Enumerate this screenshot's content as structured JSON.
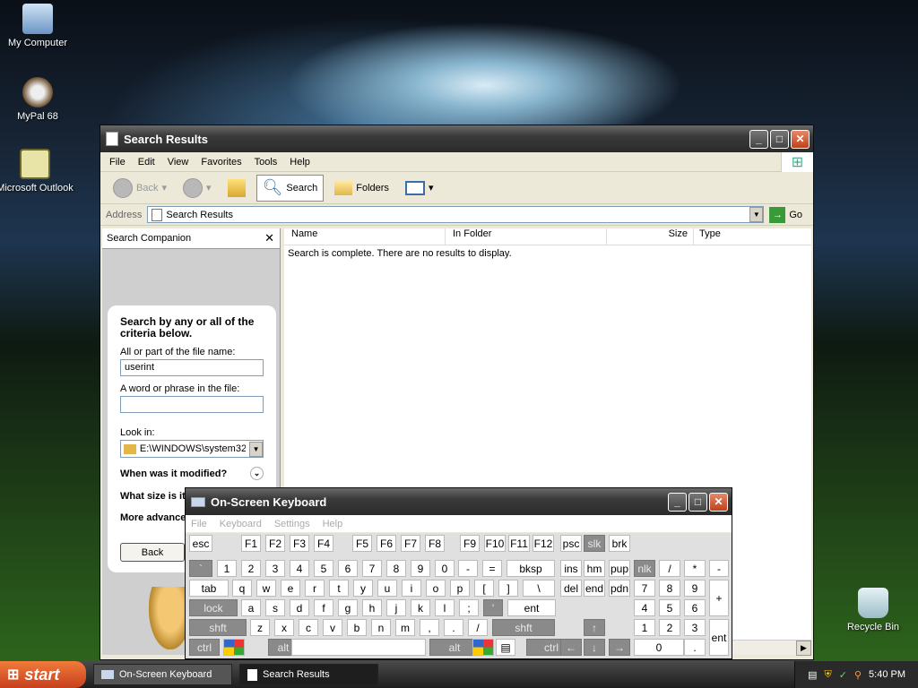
{
  "desktop": {
    "icons": [
      {
        "label": "My Computer"
      },
      {
        "label": "MyPal 68"
      },
      {
        "label": "Microsoft Outlook"
      },
      {
        "label": "Recycle Bin"
      }
    ]
  },
  "explorer": {
    "title": "Search Results",
    "menu": [
      "File",
      "Edit",
      "View",
      "Favorites",
      "Tools",
      "Help"
    ],
    "toolbar": {
      "back": "Back",
      "search": "Search",
      "folders": "Folders"
    },
    "address": {
      "label": "Address",
      "value": "Search Results",
      "go": "Go"
    },
    "companion": {
      "title": "Search Companion",
      "heading": "Search by any or all of the criteria below.",
      "file_label": "All or part of the file name:",
      "file_value": "userint",
      "word_label": "A word or phrase in the file:",
      "word_value": "",
      "look_label": "Look in:",
      "look_value": "E:\\WINDOWS\\system32",
      "modified": "When was it modified?",
      "size": "What size is it?",
      "advanced": "More advanced options",
      "back_btn": "Back"
    },
    "columns": [
      "Name",
      "In Folder",
      "Size",
      "Type"
    ],
    "message": "Search is complete. There are no results to display."
  },
  "osk": {
    "title": "On-Screen Keyboard",
    "menu": [
      "File",
      "Keyboard",
      "Settings",
      "Help"
    ],
    "rows": [
      [
        "esc",
        "F1",
        "F2",
        "F3",
        "F4",
        "F5",
        "F6",
        "F7",
        "F8",
        "F9",
        "F10",
        "F11",
        "F12",
        "psc",
        "slk",
        "brk"
      ],
      [
        "`",
        "1",
        "2",
        "3",
        "4",
        "5",
        "6",
        "7",
        "8",
        "9",
        "0",
        "-",
        "=",
        "bksp",
        "ins",
        "hm",
        "pup",
        "nlk",
        "/",
        "*",
        "-"
      ],
      [
        "tab",
        "q",
        "w",
        "e",
        "r",
        "t",
        "y",
        "u",
        "i",
        "o",
        "p",
        "[",
        "]",
        "\\",
        "del",
        "end",
        "pdn",
        "7",
        "8",
        "9",
        "+"
      ],
      [
        "lock",
        "a",
        "s",
        "d",
        "f",
        "g",
        "h",
        "j",
        "k",
        "l",
        ";",
        "'",
        "ent",
        "4",
        "5",
        "6"
      ],
      [
        "shft",
        "z",
        "x",
        "c",
        "v",
        "b",
        "n",
        "m",
        ",",
        ".",
        "/",
        "shft",
        "↑",
        "1",
        "2",
        "3",
        "ent"
      ],
      [
        "ctrl",
        "alt",
        "alt",
        "ctrl",
        "←",
        "↓",
        "→",
        "0",
        "."
      ]
    ]
  },
  "taskbar": {
    "start": "start",
    "tasks": [
      "On-Screen Keyboard",
      "Search Results"
    ],
    "clock": "5:40 PM"
  }
}
